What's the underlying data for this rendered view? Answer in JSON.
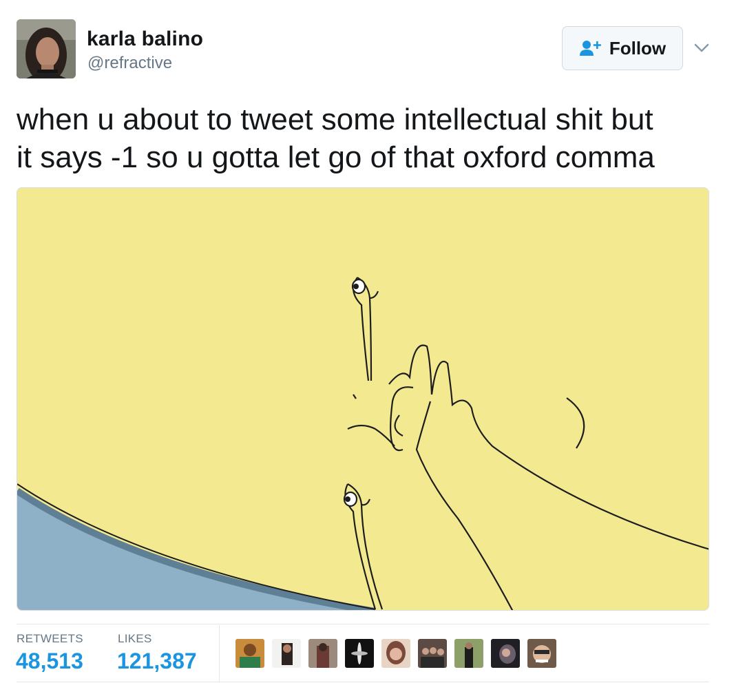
{
  "tweet": {
    "author_name": "karla balino",
    "author_handle": "@refractive",
    "follow_label": "Follow",
    "text_lines": [
      "when u about to tweet some intellectual shit but",
      "it says -1 so u gotta let go of that oxford comma"
    ]
  },
  "stats": {
    "retweets_label": "RETWEETS",
    "retweets_count": "48,513",
    "likes_label": "LIKES",
    "likes_count": "121,387"
  },
  "likers": [
    {
      "icon": "liker-avatar-1"
    },
    {
      "icon": "liker-avatar-2"
    },
    {
      "icon": "liker-avatar-3"
    },
    {
      "icon": "liker-avatar-4"
    },
    {
      "icon": "liker-avatar-5"
    },
    {
      "icon": "liker-avatar-6"
    },
    {
      "icon": "liker-avatar-7"
    },
    {
      "icon": "liker-avatar-8"
    },
    {
      "icon": "liker-avatar-9"
    }
  ],
  "colors": {
    "accent": "#1b95e0",
    "muted": "#657786",
    "media_background": "#f3e991",
    "media_accent": "#8fb1c7"
  }
}
